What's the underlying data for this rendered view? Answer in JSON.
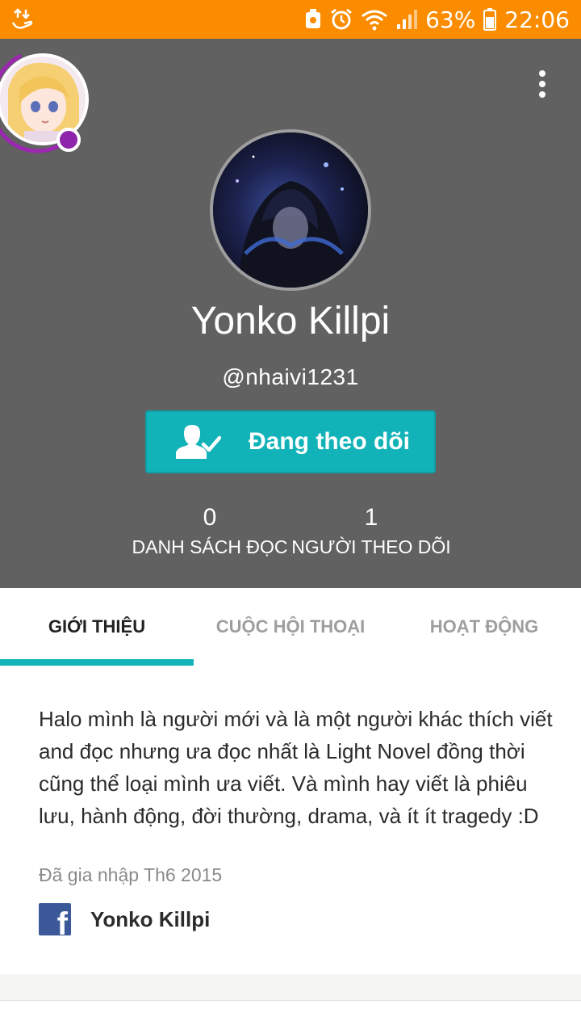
{
  "status_bar": {
    "battery_percent": "63%",
    "time": "22:06",
    "icons": [
      "upload-download-icon",
      "android-app-icon",
      "alarm-icon",
      "wifi-icon",
      "signal-icon",
      "battery-icon"
    ]
  },
  "header": {
    "display_name": "Yonko Killpi",
    "username": "@nhaivi1231",
    "follow_button_label": "Đang theo dõi",
    "stats": {
      "reading_lists_count": "0",
      "reading_lists_label": "DANH SÁCH ĐỌC",
      "followers_count": "1",
      "followers_label": "NGƯỜI THEO DÕI"
    }
  },
  "tabs": [
    {
      "label": "GIỚI THIỆU",
      "active": true
    },
    {
      "label": "CUỘC HỘI THOẠI",
      "active": false
    },
    {
      "label": "HOẠT ĐỘNG",
      "active": false
    }
  ],
  "about": {
    "bio": "Halo mình là người mới và là một người khác thích viết and đọc nhưng ưa đọc nhất là Light Novel đồng thời cũng thể loại mình ưa viết. Và mình hay viết là phiêu lưu, hành động, đời thường, drama, và ít ít tragedy :D",
    "joined": "Đã gia nhập Th6 2015",
    "facebook_name": "Yonko Killpi"
  },
  "colors": {
    "status_bar": "#fb8c00",
    "header_bg": "#616161",
    "accent": "#12b3b8",
    "facebook": "#3b5998"
  }
}
